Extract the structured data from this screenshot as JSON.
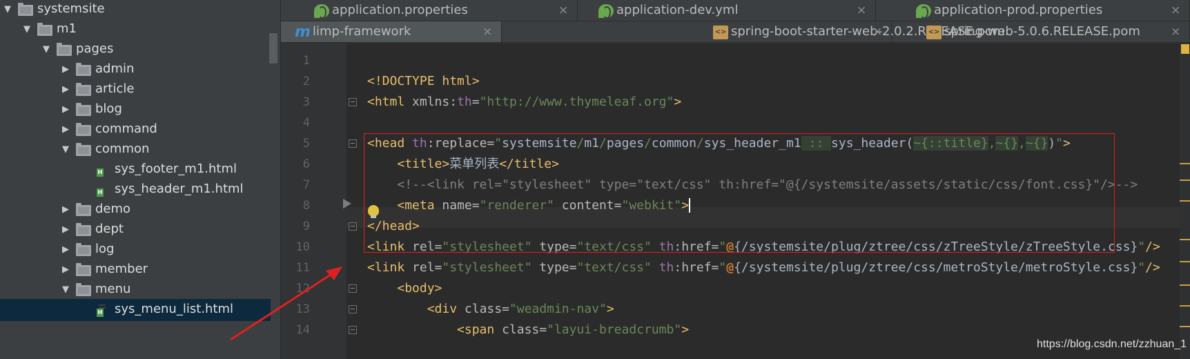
{
  "colors": {
    "sidebar_bg": "#3c3f41",
    "editor_bg": "#2b2b2b",
    "gutter_bg": "#313335",
    "selection": "#0d293e",
    "annotation_red": "#e02020",
    "tag": "#e8bf6a",
    "string": "#6a8759",
    "comment": "#808080"
  },
  "sidebar": {
    "items": [
      {
        "label": "systemsite",
        "type": "folder",
        "expanded": true,
        "depth": 0
      },
      {
        "label": "m1",
        "type": "folder",
        "expanded": true,
        "depth": 1
      },
      {
        "label": "pages",
        "type": "folder",
        "expanded": true,
        "depth": 2
      },
      {
        "label": "admin",
        "type": "folder",
        "expanded": false,
        "depth": 3
      },
      {
        "label": "article",
        "type": "folder",
        "expanded": false,
        "depth": 3
      },
      {
        "label": "blog",
        "type": "folder",
        "expanded": false,
        "depth": 3
      },
      {
        "label": "command",
        "type": "folder",
        "expanded": false,
        "depth": 3
      },
      {
        "label": "common",
        "type": "folder",
        "expanded": true,
        "depth": 3
      },
      {
        "label": "sys_footer_m1.html",
        "type": "html-file",
        "depth": 4
      },
      {
        "label": "sys_header_m1.html",
        "type": "html-file",
        "depth": 4
      },
      {
        "label": "demo",
        "type": "folder",
        "expanded": false,
        "depth": 3
      },
      {
        "label": "dept",
        "type": "folder",
        "expanded": false,
        "depth": 3
      },
      {
        "label": "log",
        "type": "folder",
        "expanded": false,
        "depth": 3
      },
      {
        "label": "member",
        "type": "folder",
        "expanded": false,
        "depth": 3
      },
      {
        "label": "menu",
        "type": "folder",
        "expanded": true,
        "depth": 3
      },
      {
        "label": "sys_menu_list.html",
        "type": "html-file",
        "depth": 4,
        "selected": true
      }
    ]
  },
  "tabs": {
    "row1": [
      {
        "label": "application.properties",
        "icon": "spring-leaf-icon"
      },
      {
        "label": "application-dev.yml",
        "icon": "spring-leaf-icon"
      },
      {
        "label": "application-prod.properties",
        "icon": "spring-leaf-icon"
      }
    ],
    "row2": [
      {
        "label": "limp-framework",
        "icon": "module-m-icon"
      },
      {
        "label": "spring-boot-starter-web-2.0.2.RELEASE.pom",
        "icon": "maven-pom-icon"
      },
      {
        "label": "spring-web-5.0.6.RELEASE.pom",
        "icon": "maven-pom-icon"
      }
    ],
    "close_glyph": "×"
  },
  "editor": {
    "lines": [
      {
        "n": "1",
        "tokens": []
      },
      {
        "n": "2",
        "tokens": [
          [
            "tag",
            "<!DOCTYPE html>"
          ]
        ]
      },
      {
        "n": "3",
        "tokens": [
          [
            "tag",
            "<html "
          ],
          [
            "attr",
            "xmlns:"
          ],
          [
            "th",
            "th"
          ],
          [
            "attr",
            "="
          ],
          [
            "str",
            "\"http://www.thymeleaf.org\""
          ],
          [
            "tag",
            ">"
          ]
        ]
      },
      {
        "n": "4",
        "tokens": []
      },
      {
        "n": "5",
        "tokens": [
          [
            "tag",
            "<head "
          ],
          [
            "th",
            "th"
          ],
          [
            "attr",
            ":replace="
          ],
          [
            "str",
            "\""
          ],
          [
            "path",
            "systemsite"
          ],
          [
            "str",
            "/"
          ],
          [
            "path",
            "m1"
          ],
          [
            "str",
            "/"
          ],
          [
            "path",
            "pages"
          ],
          [
            "str",
            "/"
          ],
          [
            "path",
            "common"
          ],
          [
            "str",
            "/"
          ],
          [
            "path",
            "sys_header_m1"
          ],
          [
            "hl",
            " :: "
          ],
          [
            "path",
            "sys_header("
          ],
          [
            "hl",
            "~{::title}"
          ],
          [
            "str",
            ","
          ],
          [
            "hl",
            "~{}"
          ],
          [
            "str",
            ","
          ],
          [
            "hl",
            "~{}"
          ],
          [
            "path",
            ")"
          ],
          [
            "str",
            "\""
          ],
          [
            "tag",
            ">"
          ]
        ]
      },
      {
        "n": "6",
        "tokens": [
          [
            "ws",
            "    "
          ],
          [
            "tag",
            "<title>"
          ],
          [
            "path",
            "菜单列表"
          ],
          [
            "tag",
            "</title>"
          ]
        ]
      },
      {
        "n": "7",
        "tokens": [
          [
            "ws",
            "    "
          ],
          [
            "comment",
            "<!--<link rel=\"stylesheet\" type=\"text/css\" th:href=\"@{/systemsite/assets/static/css/font.css}\"/>-->"
          ]
        ]
      },
      {
        "n": "8",
        "tokens": [
          [
            "ws",
            "    "
          ],
          [
            "tag",
            "<meta "
          ],
          [
            "attr",
            "name="
          ],
          [
            "str",
            "\"renderer\""
          ],
          [
            "attr",
            " content="
          ],
          [
            "str",
            "\"webkit\""
          ],
          [
            "tag",
            ">"
          ],
          [
            "cursor",
            ""
          ]
        ]
      },
      {
        "n": "9",
        "tokens": [
          [
            "tag",
            "</head>"
          ]
        ]
      },
      {
        "n": "10",
        "tokens": [
          [
            "tag",
            "<link "
          ],
          [
            "attr",
            "rel="
          ],
          [
            "str",
            "\"stylesheet\""
          ],
          [
            "attr",
            " type="
          ],
          [
            "str",
            "\"text/css\""
          ],
          [
            "attr",
            " "
          ],
          [
            "th",
            "th"
          ],
          [
            "attr",
            ":href="
          ],
          [
            "str",
            "\""
          ],
          [
            "at",
            "@"
          ],
          [
            "path",
            "{/systemsite/plug/ztree/css/zTreeStyle/zTreeStyle.css}"
          ],
          [
            "str",
            "\""
          ],
          [
            "tag",
            "/>"
          ]
        ]
      },
      {
        "n": "11",
        "tokens": [
          [
            "tag",
            "<link "
          ],
          [
            "attr",
            "rel="
          ],
          [
            "str",
            "\"stylesheet\""
          ],
          [
            "attr",
            " type="
          ],
          [
            "str",
            "\"text/css\""
          ],
          [
            "attr",
            " "
          ],
          [
            "th",
            "th"
          ],
          [
            "attr",
            ":href="
          ],
          [
            "str",
            "\""
          ],
          [
            "at",
            "@"
          ],
          [
            "path",
            "{/systemsite/plug/ztree/css/metroStyle/metroStyle.css}"
          ],
          [
            "str",
            "\""
          ],
          [
            "tag",
            "/>"
          ]
        ]
      },
      {
        "n": "12",
        "tokens": [
          [
            "ws",
            "    "
          ],
          [
            "tag",
            "<body>"
          ]
        ]
      },
      {
        "n": "13",
        "tokens": [
          [
            "ws",
            "        "
          ],
          [
            "tag",
            "<div "
          ],
          [
            "attr",
            "class="
          ],
          [
            "str",
            "\"weadmin-nav\""
          ],
          [
            "tag",
            ">"
          ]
        ]
      },
      {
        "n": "14",
        "tokens": [
          [
            "ws",
            "            "
          ],
          [
            "tag",
            "<span "
          ],
          [
            "attr",
            "class="
          ],
          [
            "str",
            "\"layui-breadcrumb\""
          ],
          [
            "tag",
            ">"
          ]
        ]
      }
    ]
  },
  "watermark": "https://blog.csdn.net/zzhuan_1"
}
